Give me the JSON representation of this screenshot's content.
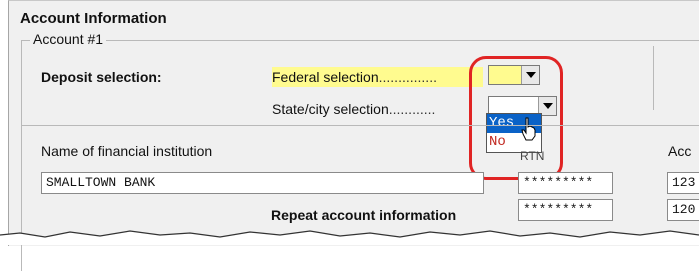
{
  "section_title": "Account Information",
  "account_group": {
    "legend": "Account #1"
  },
  "deposit": {
    "label": "Deposit selection:",
    "federal_label": "Federal selection",
    "federal_dots": "...............",
    "federal_value": "",
    "state_label": "State/city selection",
    "state_dots": "............",
    "state_value": "",
    "dropdown_options": [
      "Yes",
      "No"
    ],
    "selected_option": "Yes"
  },
  "institution": {
    "label": "Name of financial institution",
    "value": "SMALLTOWN BANK",
    "rtn_header": "RTN",
    "account_header": "Acc",
    "rtn_value_1": "*********",
    "rtn_value_2": "*********",
    "account_value_1": "123",
    "account_value_2": "120"
  },
  "repeat_label": "Repeat account information",
  "colors": {
    "highlight_ring": "#e02424",
    "selected_option": "#0a62c7",
    "federal_highlight": "#fffb8f"
  }
}
